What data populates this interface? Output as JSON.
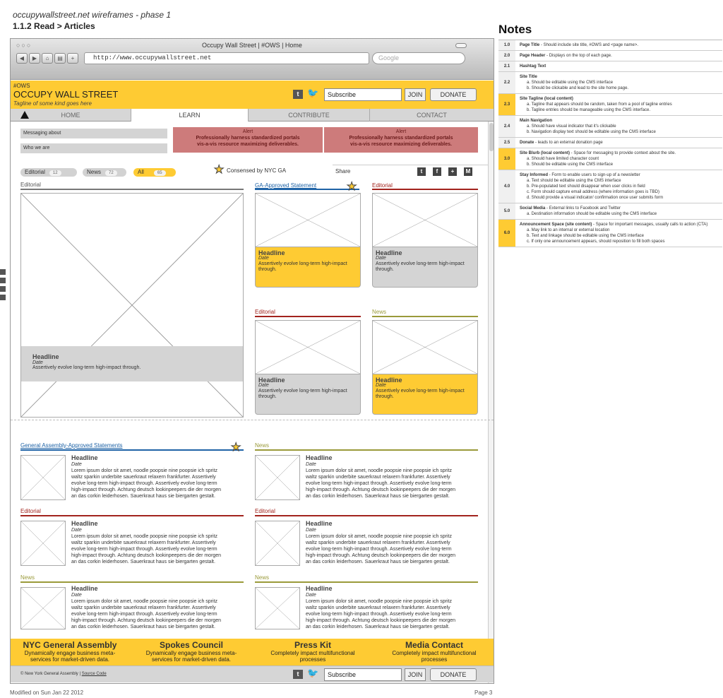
{
  "doc": {
    "title": "occupywallstreet.net wireframes - phase 1",
    "subtitle": "1.1.2 Read > Articles",
    "notes_heading": "Notes",
    "modified": "Modified on Sun Jan 22 2012",
    "page": "Page 3"
  },
  "browser": {
    "window_title": "Occupy Wall Street | #OWS | Home",
    "url": "http://www.occupywallstreet.net",
    "search_placeholder": "Google"
  },
  "header": {
    "hashtag": "#OWS",
    "site_title": "OCCUPY WALL STREET",
    "tagline": "Tagline of some kind goes here",
    "subscribe_value": "Subscribe",
    "join": "JOIN",
    "donate": "DONATE",
    "social_icon": "t"
  },
  "nav": {
    "items": [
      "HOME",
      "LEARN",
      "CONTRIBUTE",
      "CONTACT"
    ]
  },
  "blurbs": [
    "Messaging about",
    "Who we are"
  ],
  "alerts": [
    {
      "title": "Alert",
      "line1": "Professionally harness standardized portals",
      "line2": "vis-a-vis resource maximizing deliverables."
    },
    {
      "title": "Alert",
      "line1": "Professionally harness standardized portals",
      "line2": "vis-a-vis resource maximizing deliverables."
    }
  ],
  "filters": [
    {
      "label": "Editorial",
      "count": "12"
    },
    {
      "label": "News",
      "count": "72"
    },
    {
      "label": "All",
      "count": "65"
    }
  ],
  "consensed": "Consensed by NYC GA",
  "share": {
    "label": "Share",
    "icons": [
      "t",
      "f",
      "+",
      "M"
    ]
  },
  "featured": {
    "section": "Editorial",
    "headline": "Headline",
    "date": "Date",
    "text": "Assertively evolve long-term high-impact through."
  },
  "grid_cards": [
    {
      "section": "GA-Approved Statement",
      "headline": "Headline",
      "date": "Date",
      "text": "Assertively evolve long-term high-impact through."
    },
    {
      "section": "Editorial",
      "headline": "Headline",
      "date": "Date",
      "text": "Assertively evolve long-term high-impact through."
    },
    {
      "section": "Editorial",
      "headline": "Headline",
      "date": "Date",
      "text": "Assertively evolve long-term high-impact through."
    },
    {
      "section": "News",
      "headline": "Headline",
      "date": "Date",
      "text": "Assertively evolve long-term high-impact through."
    }
  ],
  "list_sections": [
    {
      "section": "General Assembly-Approved Statements",
      "headline": "Headline",
      "date": "Date"
    },
    {
      "section": "News",
      "headline": "Headline",
      "date": "Date"
    },
    {
      "section": "Editorial",
      "headline": "Headline",
      "date": "Date"
    },
    {
      "section": "Editorial",
      "headline": "Headline",
      "date": "Date"
    },
    {
      "section": "News",
      "headline": "Headline",
      "date": "Date"
    },
    {
      "section": "News",
      "headline": "Headline",
      "date": "Date"
    }
  ],
  "lorem": {
    "l1": "Lorem ipsum dolor sit amet, noodle poopsie nine poopsie ich spritz",
    "l2": "waltz sparkin underbite sauerkraut relaxern frankfurter.  Assertively",
    "l3": "evolve long-term high-impact through. Assertively evolve long-term",
    "l4": "high-impact through. Achtung deutsch lookinpeepers die der morgen",
    "l5": "an das corkin leiderhosen. Sauerkraut haus sie biergarten gestalt."
  },
  "footer": {
    "cols": [
      {
        "title": "NYC General Assembly",
        "line1": "Dynamically engage business meta-",
        "line2": "services for market-driven data."
      },
      {
        "title": "Spokes Council",
        "line1": "Dynamically engage business meta-",
        "line2": "services for market-driven data."
      },
      {
        "title": "Press Kit",
        "line1": "Completely impact multifunctional",
        "line2": "processes"
      },
      {
        "title": "Media Contact",
        "line1": "Completely impact multifunctional",
        "line2": "processes"
      }
    ],
    "copyright": "© New York General Assembly | ",
    "source_code": "Source Code",
    "subscribe_value": "Subscribe",
    "join": "JOIN",
    "donate": "DONATE"
  },
  "notes": [
    {
      "num": "1.0",
      "y": false,
      "head": "Page Title",
      "desc": " - Should include site title, #OWS and <page name>.",
      "items": []
    },
    {
      "num": "2.0",
      "y": false,
      "head": "Page Header",
      "desc": " - Displays on the top of each page.",
      "items": []
    },
    {
      "num": "2.1",
      "y": false,
      "head": "Hashtag Text",
      "desc": "",
      "items": []
    },
    {
      "num": "2.2",
      "y": false,
      "head": "Site Title",
      "desc": "",
      "items": [
        "a.   Should be editable using the CMS interface",
        "b.   Should be clickable and lead to the site home page."
      ]
    },
    {
      "num": "2.3",
      "y": true,
      "head": "Site Tagline (local content)",
      "desc": "",
      "items": [
        "a.   Tagline that appears should be random, taken from a pool of tagline entries",
        "b.   Tagline entries should be manageable using the CMS interface."
      ]
    },
    {
      "num": "2.4",
      "y": false,
      "head": "Main Navigation",
      "desc": "",
      "items": [
        "a.   Should have visual indicator that it's clickable",
        "b.   Navigation display text should be editable using the CMS interface"
      ]
    },
    {
      "num": "2.5",
      "y": false,
      "head": "Donate",
      "desc": " - leads to an external donation page",
      "items": []
    },
    {
      "num": "3.0",
      "y": true,
      "head": "Site Blurb (local content)",
      "desc": " - Space for messaging to provide context about the site.",
      "items": [
        "a.   Should have limited character count",
        "b.   Should be editable using the CMS interface"
      ]
    },
    {
      "num": "4.0",
      "y": false,
      "head": "Stay Informed",
      "desc": " - Form to enable users to sign-up of a newsletter",
      "items": [
        "a.   Text should be editable using the CMS interface",
        "b.   Pre-populated text should disappear when user clicks in field",
        "c.   Form should capture email address (where information goes is TBD)",
        "d.   Should provide a visual indicator/ confirmation once user submits form"
      ]
    },
    {
      "num": "5.0",
      "y": false,
      "head": "Social Media",
      "desc": " - External links to Facebook and Twitter",
      "items": [
        "a.   Destination information should be editable using the CMS interface"
      ]
    },
    {
      "num": "6.0",
      "y": true,
      "head": "Announcement Space (site content)",
      "desc": " - Space for important messages, usually calls to action (CTA)",
      "items": [
        "a.   May link to an internal or external location",
        "b.   Text and linkage should be editable using the CMS interface",
        "c.   If only one announcement appears, should reposition to fill both spaces"
      ]
    }
  ],
  "colors": {
    "yellow": "#fecb33",
    "alert": "#cd7b7b",
    "ga_blue": "#1f63a6",
    "editorial_red": "#a2231d",
    "news_olive": "#9a9a3a",
    "gray_bar": "#777777"
  }
}
